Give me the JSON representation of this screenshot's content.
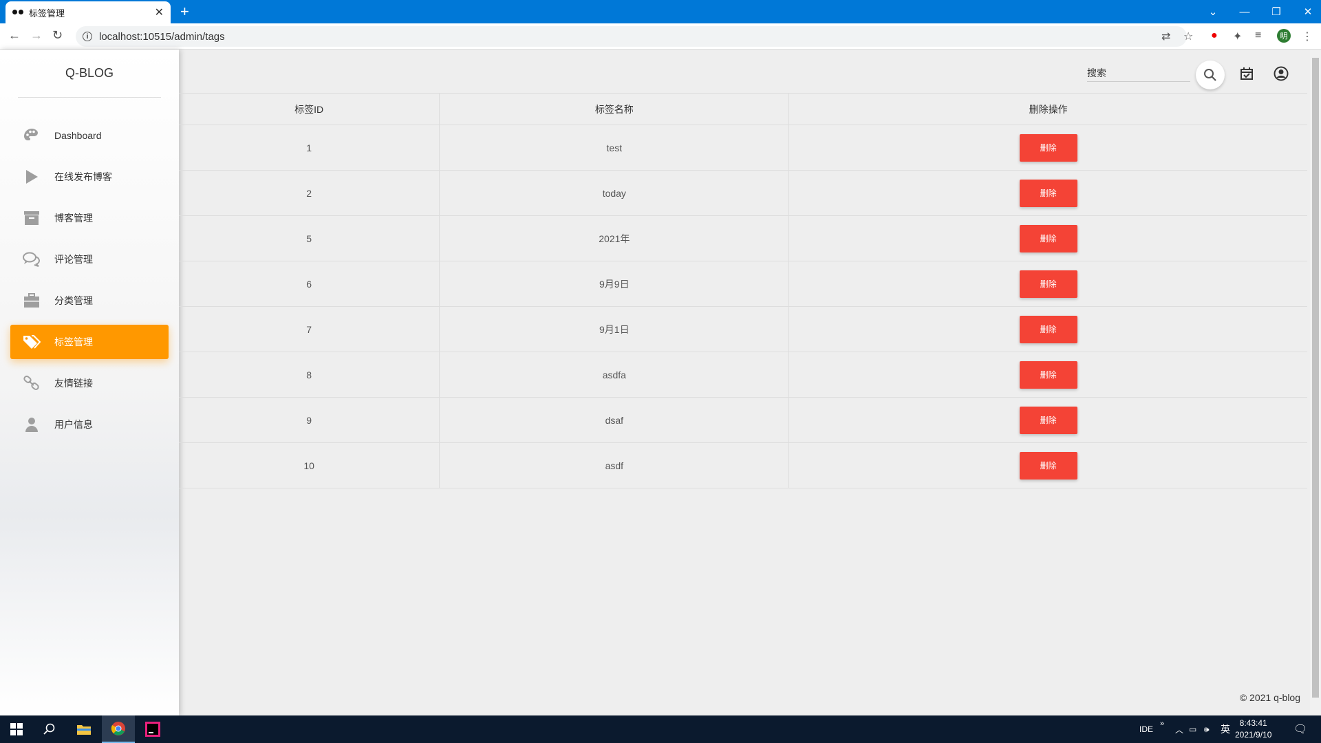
{
  "browser": {
    "tab_title": "标签管理",
    "url": "localhost:10515/admin/tags"
  },
  "sidebar": {
    "brand": "Q-BLOG",
    "items": [
      {
        "label": "Dashboard",
        "icon": "palette-icon"
      },
      {
        "label": "在线发布博客",
        "icon": "play-icon"
      },
      {
        "label": "博客管理",
        "icon": "archive-icon"
      },
      {
        "label": "评论管理",
        "icon": "comments-icon"
      },
      {
        "label": "分类管理",
        "icon": "briefcase-icon"
      },
      {
        "label": "标签管理",
        "icon": "tags-icon",
        "active": true
      },
      {
        "label": "友情链接",
        "icon": "link-icon"
      },
      {
        "label": "用户信息",
        "icon": "user-icon"
      }
    ]
  },
  "topbar": {
    "search_placeholder": "搜索"
  },
  "table": {
    "headers": [
      "标签ID",
      "标签名称",
      "删除操作"
    ],
    "rows": [
      {
        "id": "1",
        "name": "test",
        "action": "删除"
      },
      {
        "id": "2",
        "name": "today",
        "action": "删除"
      },
      {
        "id": "5",
        "name": "2021年",
        "action": "删除"
      },
      {
        "id": "6",
        "name": "9月9日",
        "action": "删除"
      },
      {
        "id": "7",
        "name": "9月1日",
        "action": "删除"
      },
      {
        "id": "8",
        "name": "asdfa",
        "action": "删除"
      },
      {
        "id": "9",
        "name": "dsaf",
        "action": "删除"
      },
      {
        "id": "10",
        "name": "asdf",
        "action": "删除"
      }
    ]
  },
  "footer": "© 2021 q-blog",
  "taskbar": {
    "ide_label": "IDE",
    "ime": "英",
    "time": "8:43:41",
    "date": "2021/9/10"
  },
  "colors": {
    "accent": "#ff9800",
    "danger": "#f44336",
    "chrome_blue": "#0078d7"
  }
}
